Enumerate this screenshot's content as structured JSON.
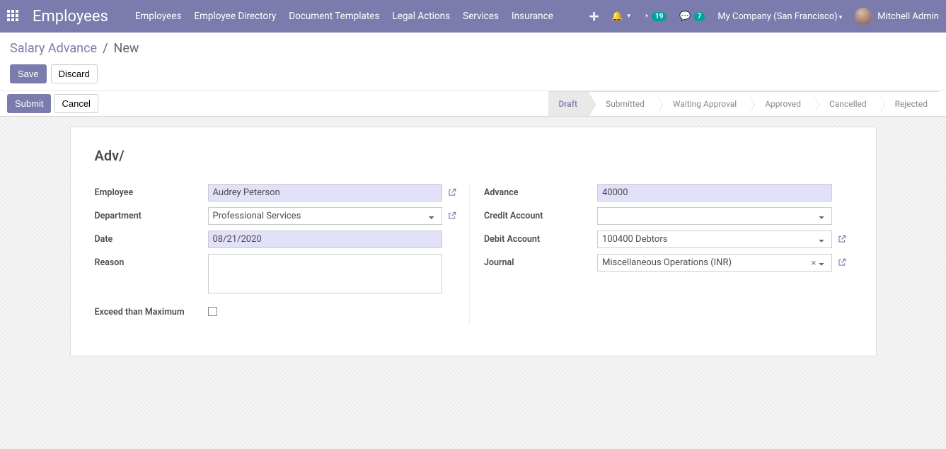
{
  "nav": {
    "app_title": "Employees",
    "menu": [
      "Employees",
      "Employee Directory",
      "Document Templates",
      "Legal Actions",
      "Services",
      "Insurance"
    ],
    "badge_activities": "19",
    "badge_messages": "7",
    "company": "My Company (San Francisco)",
    "user": "Mitchell Admin"
  },
  "breadcrumb": {
    "parent": "Salary Advance",
    "sep": "/",
    "current": "New",
    "save": "Save",
    "discard": "Discard"
  },
  "strip": {
    "submit": "Submit",
    "cancel": "Cancel",
    "stages": [
      "Draft",
      "Submitted",
      "Waiting Approval",
      "Approved",
      "Cancelled",
      "Rejected"
    ]
  },
  "form": {
    "title": "Adv/",
    "left": {
      "employee_label": "Employee",
      "employee_value": "Audrey Peterson",
      "department_label": "Department",
      "department_value": "Professional Services",
      "date_label": "Date",
      "date_value": "08/21/2020",
      "reason_label": "Reason",
      "reason_value": "",
      "exceed_label": "Exceed than Maximum"
    },
    "right": {
      "advance_label": "Advance",
      "advance_value": "40000",
      "credit_label": "Credit Account",
      "credit_value": "",
      "debit_label": "Debit Account",
      "debit_value": "100400 Debtors",
      "journal_label": "Journal",
      "journal_value": "Miscellaneous Operations (INR)"
    }
  }
}
